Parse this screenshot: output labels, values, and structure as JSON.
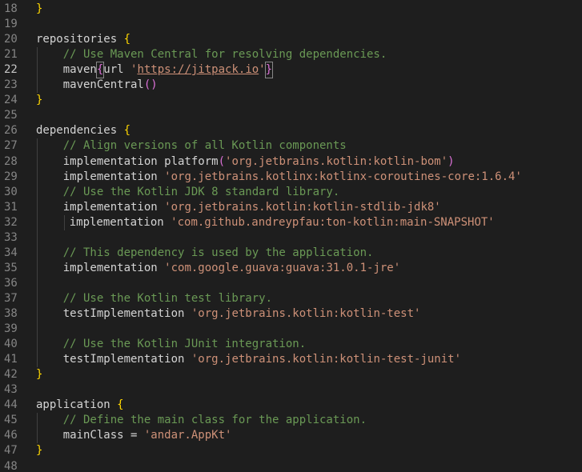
{
  "editor": {
    "lines": [
      {
        "n": "18",
        "parts": [
          {
            "t": "}",
            "c": "br"
          }
        ]
      },
      {
        "n": "19",
        "parts": []
      },
      {
        "n": "20",
        "parts": [
          {
            "t": "repositories ",
            "c": "fn"
          },
          {
            "t": "{",
            "c": "br"
          }
        ]
      },
      {
        "n": "21",
        "parts": [
          {
            "t": "    // Use Maven Central for resolving dependencies.",
            "c": "cmt"
          }
        ]
      },
      {
        "n": "22",
        "active": true,
        "parts": [
          {
            "t": "    maven",
            "c": "fn"
          },
          {
            "t": "{",
            "c": "brp",
            "box": true
          },
          {
            "t": "url ",
            "c": "fn"
          },
          {
            "t": "'",
            "c": "str"
          },
          {
            "t": "https://jitpack.io",
            "c": "url"
          },
          {
            "t": "'",
            "c": "str"
          },
          {
            "t": "}",
            "c": "brp",
            "box": true
          }
        ]
      },
      {
        "n": "23",
        "parts": [
          {
            "t": "    mavenCentral",
            "c": "fn"
          },
          {
            "t": "()",
            "c": "brp"
          }
        ]
      },
      {
        "n": "24",
        "parts": [
          {
            "t": "}",
            "c": "br"
          }
        ]
      },
      {
        "n": "25",
        "parts": []
      },
      {
        "n": "26",
        "parts": [
          {
            "t": "dependencies ",
            "c": "fn"
          },
          {
            "t": "{",
            "c": "br"
          }
        ]
      },
      {
        "n": "27",
        "parts": [
          {
            "t": "    // Align versions of all Kotlin components",
            "c": "cmt"
          }
        ]
      },
      {
        "n": "28",
        "parts": [
          {
            "t": "    implementation platform",
            "c": "fn"
          },
          {
            "t": "(",
            "c": "brp"
          },
          {
            "t": "'org.jetbrains.kotlin:kotlin-bom'",
            "c": "str"
          },
          {
            "t": ")",
            "c": "brp"
          }
        ]
      },
      {
        "n": "29",
        "parts": [
          {
            "t": "    implementation ",
            "c": "fn"
          },
          {
            "t": "'org.jetbrains.kotlinx:kotlinx-coroutines-core:1.6.4'",
            "c": "str"
          }
        ]
      },
      {
        "n": "30",
        "parts": [
          {
            "t": "    // Use the Kotlin JDK 8 standard library.",
            "c": "cmt"
          }
        ]
      },
      {
        "n": "31",
        "parts": [
          {
            "t": "    implementation ",
            "c": "fn"
          },
          {
            "t": "'org.jetbrains.kotlin:kotlin-stdlib-jdk8'",
            "c": "str"
          }
        ]
      },
      {
        "n": "32",
        "extra": true,
        "parts": [
          {
            "t": "    implementation ",
            "c": "fn"
          },
          {
            "t": "'com.github.andreypfau:ton-kotlin:main-SNAPSHOT'",
            "c": "str"
          }
        ]
      },
      {
        "n": "33",
        "parts": []
      },
      {
        "n": "34",
        "parts": [
          {
            "t": "    // This dependency is used by the application.",
            "c": "cmt"
          }
        ]
      },
      {
        "n": "35",
        "parts": [
          {
            "t": "    implementation ",
            "c": "fn"
          },
          {
            "t": "'com.google.guava:guava:31.0.1-jre'",
            "c": "str"
          }
        ]
      },
      {
        "n": "36",
        "parts": []
      },
      {
        "n": "37",
        "parts": [
          {
            "t": "    // Use the Kotlin test library.",
            "c": "cmt"
          }
        ]
      },
      {
        "n": "38",
        "parts": [
          {
            "t": "    testImplementation ",
            "c": "fn"
          },
          {
            "t": "'org.jetbrains.kotlin:kotlin-test'",
            "c": "str"
          }
        ]
      },
      {
        "n": "39",
        "parts": []
      },
      {
        "n": "40",
        "parts": [
          {
            "t": "    // Use the Kotlin JUnit integration.",
            "c": "cmt"
          }
        ]
      },
      {
        "n": "41",
        "parts": [
          {
            "t": "    testImplementation ",
            "c": "fn"
          },
          {
            "t": "'org.jetbrains.kotlin:kotlin-test-junit'",
            "c": "str"
          }
        ]
      },
      {
        "n": "42",
        "parts": [
          {
            "t": "}",
            "c": "br"
          }
        ]
      },
      {
        "n": "43",
        "parts": []
      },
      {
        "n": "44",
        "parts": [
          {
            "t": "application ",
            "c": "fn"
          },
          {
            "t": "{",
            "c": "br"
          }
        ]
      },
      {
        "n": "45",
        "parts": [
          {
            "t": "    // Define the main class for the application.",
            "c": "cmt"
          }
        ]
      },
      {
        "n": "46",
        "parts": [
          {
            "t": "    mainClass = ",
            "c": "fn"
          },
          {
            "t": "'andar.AppKt'",
            "c": "str"
          }
        ]
      },
      {
        "n": "47",
        "parts": [
          {
            "t": "}",
            "c": "br"
          }
        ]
      },
      {
        "n": "48",
        "parts": []
      }
    ]
  },
  "colors": {
    "background": "#1e1e1e",
    "comment": "#6a9955",
    "string": "#ce9178",
    "brace": "#ffd700",
    "paren": "#da70d6"
  }
}
